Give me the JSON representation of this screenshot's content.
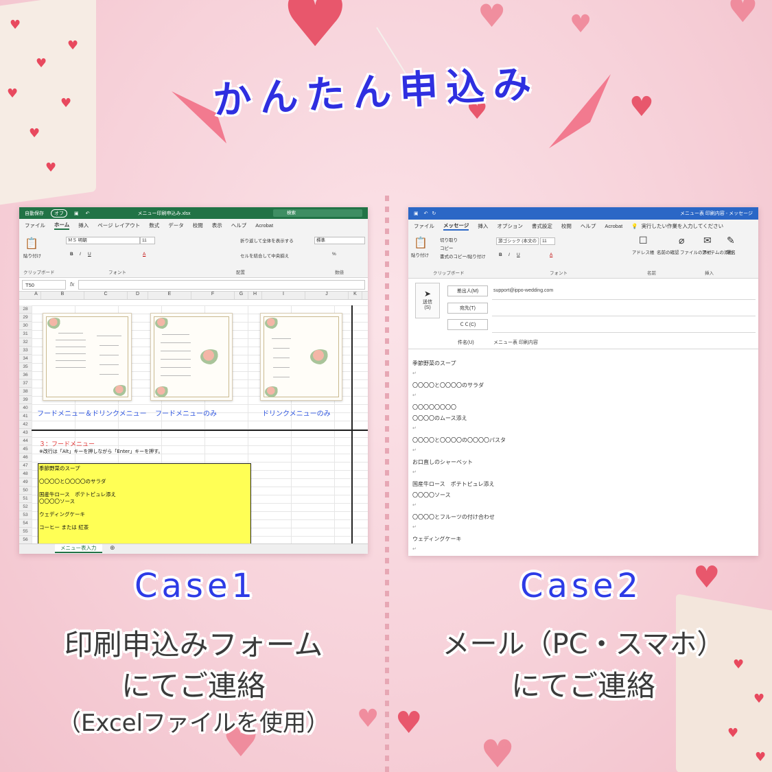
{
  "title": "かんたん申込み",
  "excel": {
    "autosave": "自動保存",
    "toggle": "オフ",
    "filename": "メニュー印刷申込み.xlsx",
    "search": "検索",
    "tabs": [
      "ファイル",
      "ホーム",
      "挿入",
      "ページ レイアウト",
      "数式",
      "データ",
      "校閲",
      "表示",
      "ヘルプ",
      "Acrobat"
    ],
    "font_name": "ＭＳ 明朝",
    "font_size": "11",
    "wrap_text": "折り返して全体を表示する",
    "merge_center": "セルを結合して中央揃え",
    "number_format": "標準",
    "groups": [
      "クリップボード",
      "フォント",
      "配置",
      "数値"
    ],
    "paste": "貼り付け",
    "name_box": "T50",
    "fx": "fx",
    "columns": [
      "A",
      "B",
      "C",
      "D",
      "E",
      "F",
      "G",
      "H",
      "I",
      "J",
      "K"
    ],
    "rows": [
      "28",
      "29",
      "30",
      "31",
      "32",
      "33",
      "34",
      "35",
      "36",
      "37",
      "38",
      "39",
      "40",
      "41",
      "42",
      "43",
      "44",
      "45",
      "46",
      "47",
      "48",
      "49",
      "50",
      "51",
      "52",
      "53",
      "54",
      "55",
      "56"
    ],
    "captions": [
      "フードメニュー＆ドリンクメニュー",
      "フードメニューのみ",
      "ドリンクメニューのみ"
    ],
    "section_title": "３：フードメニュー",
    "note": "※改行は「Alt」キーを押しながら「Enter」キーを押す。",
    "menu_items": [
      "季節野菜のスープ",
      "〇〇〇〇と〇〇〇〇のサラダ",
      "国産牛ロース　ポテトピュレ添え",
      "〇〇〇〇ソース",
      "ウェディングケーキ",
      "コーヒー または 紅茶"
    ],
    "sheet_tab": "メニュー表入力"
  },
  "outlook": {
    "title": "メニュー表 印刷内容 - メッセージ",
    "tabs": [
      "ファイル",
      "メッセージ",
      "挿入",
      "オプション",
      "書式設定",
      "校閲",
      "ヘルプ",
      "Acrobat"
    ],
    "tell_me": "実行したい作業を入力してください",
    "clipboard": {
      "paste": "貼り付け",
      "cut": "切り取り",
      "copy": "コピー",
      "format_painter": "書式のコピー/貼り付け"
    },
    "font_name": "游ゴシック (本文の",
    "font_size": "11",
    "ribbon_items": [
      "アドレス帳",
      "名前の確認",
      "ファイルの添付",
      "アイテムの添付",
      "署名"
    ],
    "groups": [
      "クリップボード",
      "フォント",
      "名前",
      "挿入"
    ],
    "send": "送信",
    "send_key": "(S)",
    "from_btn": "差出人(M)",
    "from_val": "support@ippo-wedding.com",
    "to_btn": "宛先(T)",
    "cc_btn": "ＣＣ(C)",
    "subject_label": "件名(U)",
    "subject_val": "メニュー表 印刷内容",
    "body": [
      "季節野菜のスープ",
      "〇〇〇〇と〇〇〇〇のサラダ",
      "〇〇〇〇〇〇〇〇",
      "〇〇〇〇のムース添え",
      "〇〇〇〇と〇〇〇〇の〇〇〇〇パスタ",
      "お口直しのシャーベット",
      "国産牛ロース　ポテトピュレ添え",
      "〇〇〇〇ソース",
      "〇〇〇〇とフルーツの付け合わせ",
      "ウェディングケーキ"
    ]
  },
  "case1": {
    "label": "Case1",
    "line1": "印刷申込みフォーム",
    "line2": "にてご連絡",
    "line3": "（Excelファイルを使用）"
  },
  "case2": {
    "label": "Case2",
    "line1": "メール（PC・スマホ）",
    "line2": "にてご連絡"
  },
  "colors": {
    "accent_blue": "#2d3be6",
    "excel_green": "#217346",
    "outlook_blue": "#2b67c6",
    "highlight_yellow": "#ffff55"
  }
}
